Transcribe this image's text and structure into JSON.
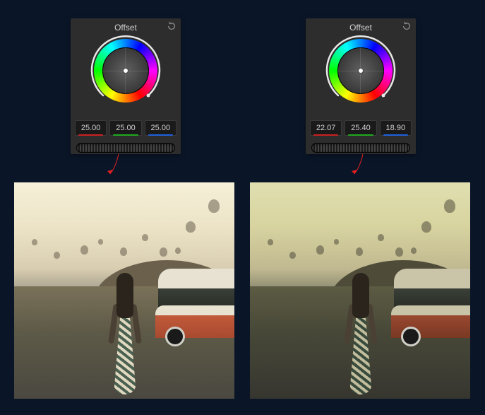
{
  "panels": {
    "left": {
      "title": "Offset",
      "r": "25.00",
      "g": "25.00",
      "b": "25.00"
    },
    "right": {
      "title": "Offset",
      "r": "22.07",
      "g": "25.40",
      "b": "18.90"
    }
  }
}
